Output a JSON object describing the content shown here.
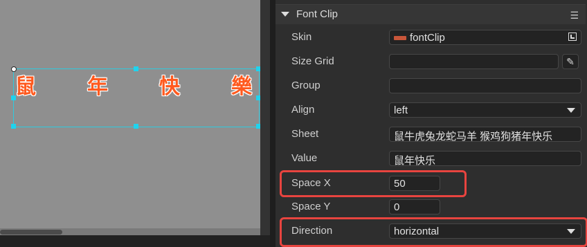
{
  "canvas": {
    "glyphs": [
      "鼠",
      "年",
      "快",
      "樂"
    ]
  },
  "panel": {
    "section_title": "Font Clip",
    "menu_icon": "☰",
    "properties": {
      "skin": {
        "label": "Skin",
        "value": "fontClip"
      },
      "size_grid": {
        "label": "Size Grid",
        "value": ""
      },
      "group": {
        "label": "Group",
        "value": ""
      },
      "align": {
        "label": "Align",
        "value": "left"
      },
      "sheet": {
        "label": "Sheet",
        "value": "鼠牛虎兔龙蛇马羊 猴鸡狗猪年快乐"
      },
      "value": {
        "label": "Value",
        "value": "鼠年快乐"
      },
      "space_x": {
        "label": "Space X",
        "value": "50"
      },
      "space_y": {
        "label": "Space Y",
        "value": "0"
      },
      "direction": {
        "label": "Direction",
        "value": "horizontal"
      }
    }
  },
  "colors": {
    "highlight": "#e8443f",
    "selection": "#2ecbe0",
    "glyph": "#ff5a1f"
  }
}
